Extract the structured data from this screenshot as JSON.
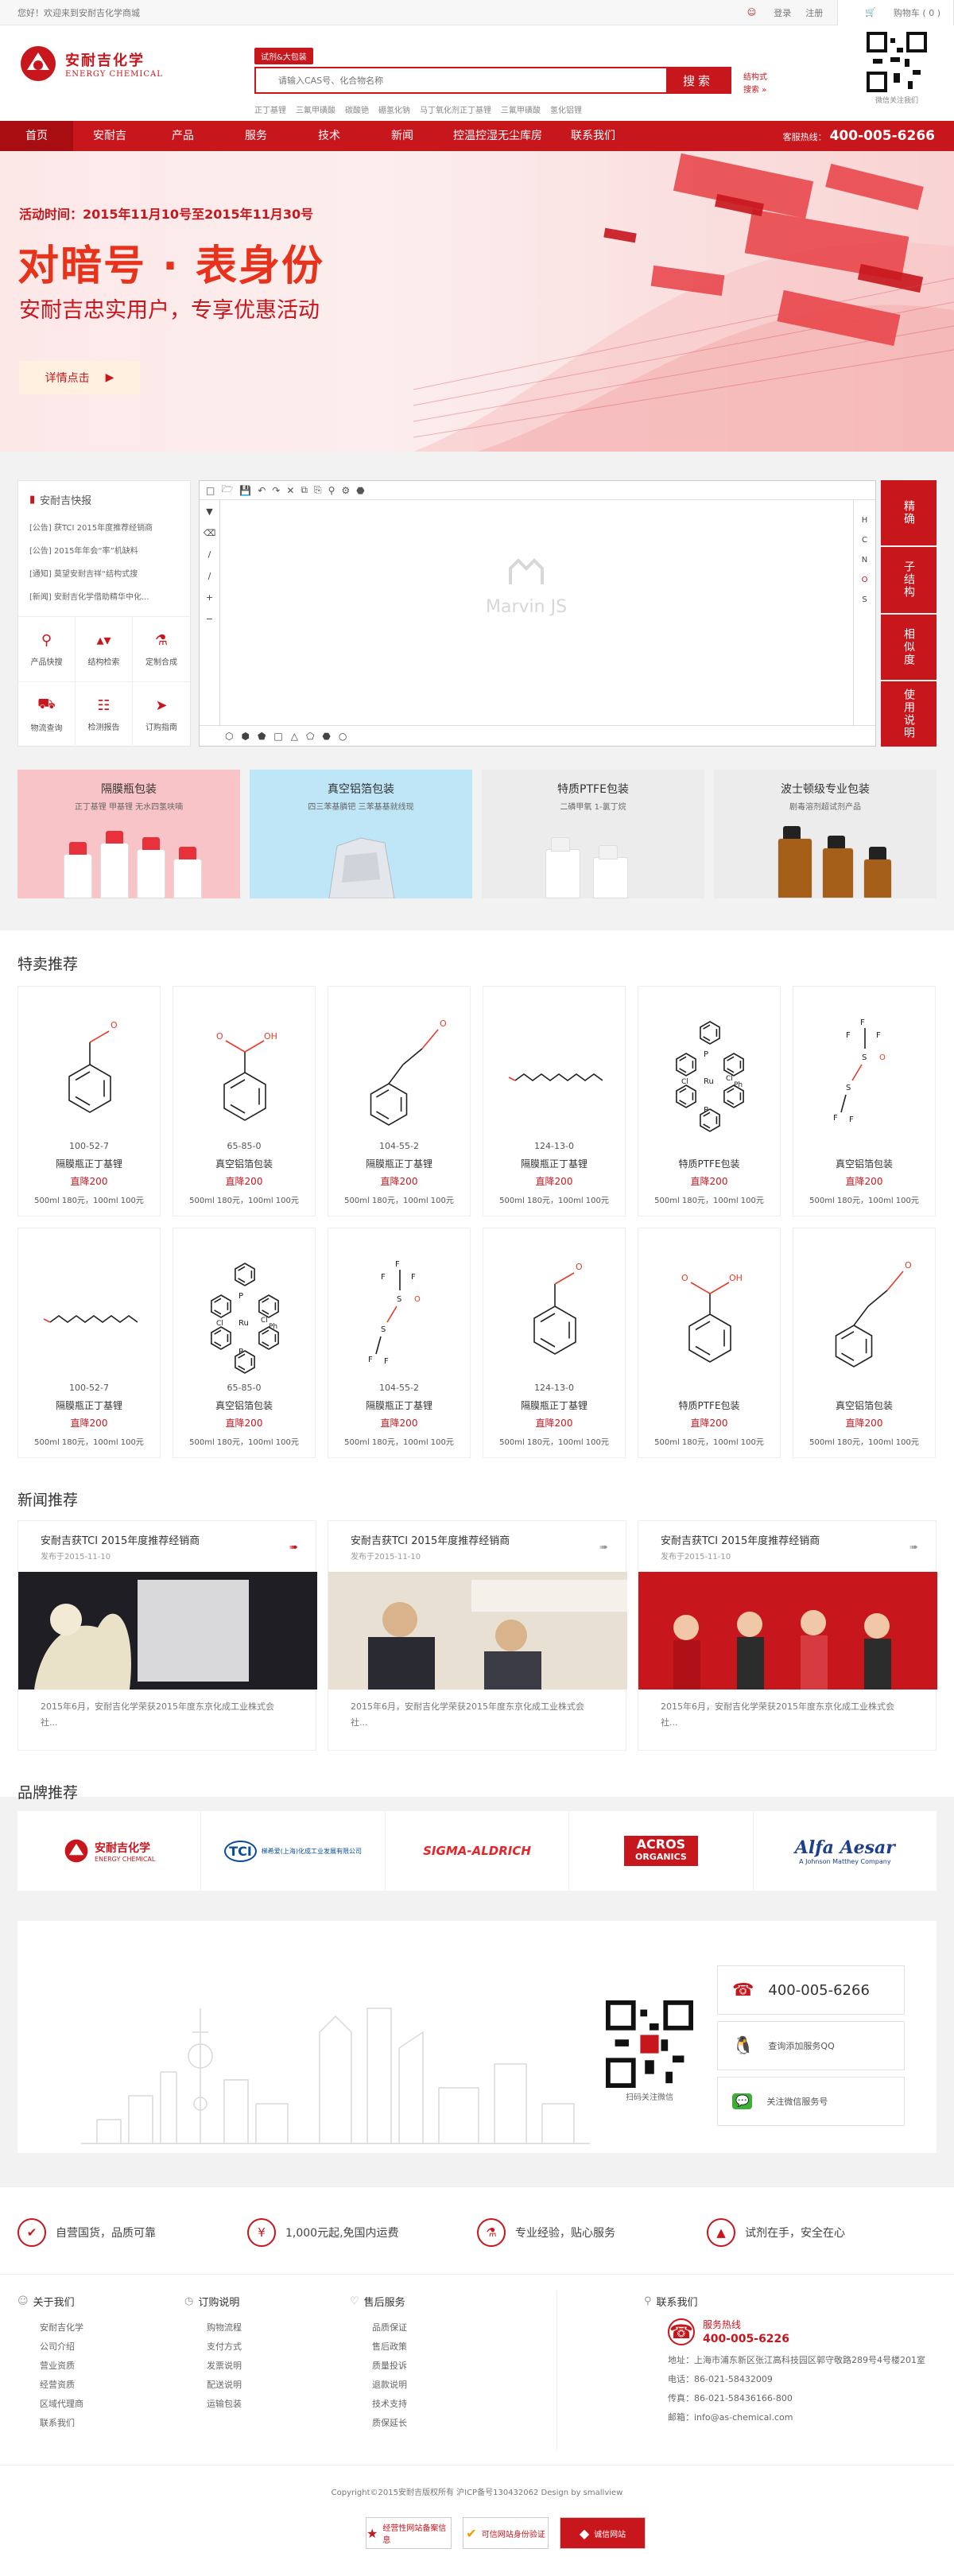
{
  "topbar": {
    "welcome": "您好！欢迎来到安耐吉化学商城",
    "login": "登录",
    "register": "注册",
    "cart": "购物车 ( 0 )"
  },
  "header": {
    "logo_cn": "安耐吉化学",
    "logo_en": "ENERGY CHEMICAL",
    "search_tag": "试剂&大包装",
    "search_placeholder": "请输入CAS号、化合物名称",
    "search_button": "搜索",
    "hotwords": [
      "正丁基锂",
      "三氟甲磺酸",
      "碳酸铯",
      "硼氢化钠",
      "马丁氧化剂正丁基锂",
      "三氟甲磺酸",
      "氢化铝锂"
    ],
    "struct_search": [
      "结构式",
      "搜索 »"
    ],
    "qr_label": "微信关注我们"
  },
  "nav": {
    "items": [
      "首页",
      "安耐吉",
      "产品",
      "服务",
      "技术",
      "新闻",
      "控温控湿无尘库房",
      "联系我们"
    ],
    "hotline_label": "客服热线：",
    "hotline": "400-005-6266"
  },
  "banner": {
    "date": "活动时间：2015年11月10号至2015年11月30号",
    "title": "对暗号 · 表身份",
    "subtitle": "安耐吉忠实用户，专享优惠活动",
    "button": "详情点击"
  },
  "kuaibao": {
    "title": "安耐吉快报",
    "news": [
      "[公告] 获TCI 2015年度推荐经销商",
      "[公告] 2015年年会“率”机缺料",
      "[通知] 莫望安耐吉祥“结构式搜",
      "[新闻] 安耐吉化学借助精华中化..."
    ],
    "grid": [
      "产品快搜",
      "结构检索",
      "定制合成",
      "物流查询",
      "检测报告",
      "订购指南"
    ]
  },
  "marvin": {
    "watermark": "Marvin JS",
    "side_letters": [
      "H",
      "C",
      "N",
      "O",
      "S"
    ],
    "side_tabs": [
      "精确",
      "子结构",
      "相似度",
      "使用说明"
    ]
  },
  "packages": [
    {
      "title": "隔膜瓶包装",
      "desc": "正丁基锂 甲基锂 无水四氢呋喃",
      "bg": "#f9c4c7"
    },
    {
      "title": "真空铝箔包装",
      "desc": "四三苯基膦钯 三苯基基就线现",
      "bg": "#bfe6f7"
    },
    {
      "title": "特质PTFE包装",
      "desc": "二磷甲氧 1-氯丁烷",
      "bg": "#ececec"
    },
    {
      "title": "波士顿级专业包装",
      "desc": "剧毒溶剂超试剂产品",
      "bg": "#ececec"
    }
  ],
  "sections": {
    "special": "特卖推荐",
    "news": "新闻推荐",
    "brand": "品牌推荐"
  },
  "products": [
    {
      "cas": "100-52-7",
      "name": "隔膜瓶正丁基锂",
      "price": "直降200",
      "spec": "500ml 180元，100ml  100元"
    },
    {
      "cas": "65-85-0",
      "name": "真空铝箔包装",
      "price": "直降200",
      "spec": "500ml 180元，100ml  100元"
    },
    {
      "cas": "104-55-2",
      "name": "隔膜瓶正丁基锂",
      "price": "直降200",
      "spec": "500ml 180元，100ml  100元"
    },
    {
      "cas": "124-13-0",
      "name": "隔膜瓶正丁基锂",
      "price": "直降200",
      "spec": "500ml 180元，100ml  100元"
    },
    {
      "cas": "",
      "name": "特质PTFE包装",
      "price": "直降200",
      "spec": "500ml 180元，100ml  100元"
    },
    {
      "cas": "",
      "name": "真空铝箔包装",
      "price": "直降200",
      "spec": "500ml 180元，100ml  100元"
    },
    {
      "cas": "100-52-7",
      "name": "隔膜瓶正丁基锂",
      "price": "直降200",
      "spec": "500ml 180元，100ml  100元"
    },
    {
      "cas": "65-85-0",
      "name": "真空铝箔包装",
      "price": "直降200",
      "spec": "500ml 180元，100ml  100元"
    },
    {
      "cas": "104-55-2",
      "name": "隔膜瓶正丁基锂",
      "price": "直降200",
      "spec": "500ml 180元，100ml  100元"
    },
    {
      "cas": "124-13-0",
      "name": "隔膜瓶正丁基锂",
      "price": "直降200",
      "spec": "500ml 180元，100ml  100元"
    },
    {
      "cas": "",
      "name": "特质PTFE包装",
      "price": "直降200",
      "spec": "500ml 180元，100ml  100元"
    },
    {
      "cas": "",
      "name": "真空铝箔包装",
      "price": "直降200",
      "spec": "500ml 180元，100ml  100元"
    }
  ],
  "news": [
    {
      "title": "安耐吉获TCI 2015年度推荐经销商",
      "date": "发布于2015-11-10",
      "excerpt": "2015年6月，安耐吉化学荣获2015年度东京化成工业株式会社..."
    },
    {
      "title": "安耐吉获TCI 2015年度推荐经销商",
      "date": "发布于2015-11-10",
      "excerpt": "2015年6月，安耐吉化学荣获2015年度东京化成工业株式会社..."
    },
    {
      "title": "安耐吉获TCI 2015年度推荐经销商",
      "date": "发布于2015-11-10",
      "excerpt": "2015年6月，安耐吉化学荣获2015年度东京化成工业株式会社..."
    }
  ],
  "brands": {
    "energy_cn": "安耐吉化学",
    "energy_en": "ENERGY CHEMICAL",
    "tci": "梯希爱(上海)化成工业发展有限公司",
    "sigma": "SIGMA-ALDRICH",
    "acros1": "ACROS",
    "acros2": "ORGANICS",
    "alfa": "Alfa Aesar",
    "alfa_sub": "A Johnson Matthey Company"
  },
  "contact": {
    "qr_label": "扫码关注微信",
    "phone": "400-005-6266",
    "qq": "查询添加服务QQ",
    "wechat": "关注微信服务号"
  },
  "features": [
    "自营国货，品质可靠",
    "1,000元起,免国内运费",
    "专业经验，贴心服务",
    "试剂在手，安全在心"
  ],
  "footer": {
    "about": {
      "title": "关于我们",
      "links": [
        "安耐吉化学",
        "公司介绍",
        "营业资质",
        "经营资质",
        "区域代理商",
        "联系我们"
      ]
    },
    "order": {
      "title": "订购说明",
      "links": [
        "购物流程",
        "支付方式",
        "发票说明",
        "配送说明",
        "运输包装"
      ]
    },
    "service": {
      "title": "售后服务",
      "links": [
        "品质保证",
        "售后政策",
        "质量投诉",
        "退款说明",
        "技术支持",
        "质保延长"
      ]
    },
    "contact": {
      "title": "联系我们",
      "hotline_label": "服务热线",
      "hotline": "400-005-6226",
      "address": "地址：上海市浦东新区张江高科技园区郭守敬路289号4号楼201室",
      "tel": "电话：86-021-58432009",
      "fax": "传真：86-021-58436166-800",
      "email": "邮箱：info@as-chemical.com"
    }
  },
  "copyright": "Copyright©2015安耐吉版权所有 沪ICP备号130432062  Design by smallview",
  "badges": [
    "经营性网站备案信息",
    "可信网站身份验证",
    "诚信网站"
  ],
  "colors": {
    "brand": "#c8161d",
    "price": "#c8161d"
  }
}
